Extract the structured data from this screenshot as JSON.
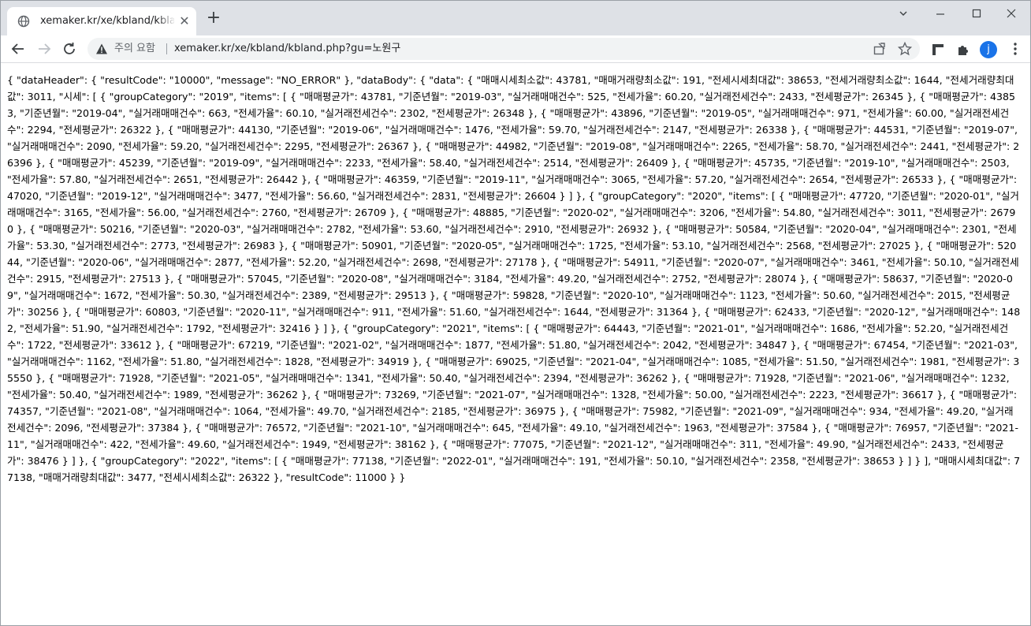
{
  "tab": {
    "title": "xemaker.kr/xe/kbland/kbland.php?gu=노원구",
    "globe_icon": "globe-icon"
  },
  "address_bar": {
    "warning_label": "주의 요함",
    "url": "xemaker.kr/xe/kbland/kbland.php?gu=노원구"
  },
  "profile": {
    "initial": "j",
    "color": "#1a73e8"
  },
  "page": {
    "body_text": "{ \"dataHeader\": { \"resultCode\": \"10000\", \"message\": \"NO_ERROR\" }, \"dataBody\": { \"data\": { \"매매시세최소값\": 43781, \"매매거래량최소값\": 191, \"전세시세최대값\": 38653, \"전세거래량최소값\": 1644, \"전세거래량최대값\": 3011, \"시세\": [ { \"groupCategory\": \"2019\", \"items\": [ { \"매매평균가\": 43781, \"기준년월\": \"2019-03\", \"실거래매매건수\": 525, \"전세가율\": 60.20, \"실거래전세건수\": 2433, \"전세평균가\": 26345 }, { \"매매평균가\": 43853, \"기준년월\": \"2019-04\", \"실거래매매건수\": 663, \"전세가율\": 60.10, \"실거래전세건수\": 2302, \"전세평균가\": 26348 }, { \"매매평균가\": 43896, \"기준년월\": \"2019-05\", \"실거래매매건수\": 971, \"전세가율\": 60.00, \"실거래전세건수\": 2294, \"전세평균가\": 26322 }, { \"매매평균가\": 44130, \"기준년월\": \"2019-06\", \"실거래매매건수\": 1476, \"전세가율\": 59.70, \"실거래전세건수\": 2147, \"전세평균가\": 26338 }, { \"매매평균가\": 44531, \"기준년월\": \"2019-07\", \"실거래매매건수\": 2090, \"전세가율\": 59.20, \"실거래전세건수\": 2295, \"전세평균가\": 26367 }, { \"매매평균가\": 44982, \"기준년월\": \"2019-08\", \"실거래매매건수\": 2265, \"전세가율\": 58.70, \"실거래전세건수\": 2441, \"전세평균가\": 26396 }, { \"매매평균가\": 45239, \"기준년월\": \"2019-09\", \"실거래매매건수\": 2233, \"전세가율\": 58.40, \"실거래전세건수\": 2514, \"전세평균가\": 26409 }, { \"매매평균가\": 45735, \"기준년월\": \"2019-10\", \"실거래매매건수\": 2503, \"전세가율\": 57.80, \"실거래전세건수\": 2651, \"전세평균가\": 26442 }, { \"매매평균가\": 46359, \"기준년월\": \"2019-11\", \"실거래매매건수\": 3065, \"전세가율\": 57.20, \"실거래전세건수\": 2654, \"전세평균가\": 26533 }, { \"매매평균가\": 47020, \"기준년월\": \"2019-12\", \"실거래매매건수\": 3477, \"전세가율\": 56.60, \"실거래전세건수\": 2831, \"전세평균가\": 26604 } ] }, { \"groupCategory\": \"2020\", \"items\": [ { \"매매평균가\": 47720, \"기준년월\": \"2020-01\", \"실거래매매건수\": 3165, \"전세가율\": 56.00, \"실거래전세건수\": 2760, \"전세평균가\": 26709 }, { \"매매평균가\": 48885, \"기준년월\": \"2020-02\", \"실거래매매건수\": 3206, \"전세가율\": 54.80, \"실거래전세건수\": 3011, \"전세평균가\": 26790 }, { \"매매평균가\": 50216, \"기준년월\": \"2020-03\", \"실거래매매건수\": 2782, \"전세가율\": 53.60, \"실거래전세건수\": 2910, \"전세평균가\": 26932 }, { \"매매평균가\": 50584, \"기준년월\": \"2020-04\", \"실거래매매건수\": 2301, \"전세가율\": 53.30, \"실거래전세건수\": 2773, \"전세평균가\": 26983 }, { \"매매평균가\": 50901, \"기준년월\": \"2020-05\", \"실거래매매건수\": 1725, \"전세가율\": 53.10, \"실거래전세건수\": 2568, \"전세평균가\": 27025 }, { \"매매평균가\": 52044, \"기준년월\": \"2020-06\", \"실거래매매건수\": 2877, \"전세가율\": 52.20, \"실거래전세건수\": 2698, \"전세평균가\": 27178 }, { \"매매평균가\": 54911, \"기준년월\": \"2020-07\", \"실거래매매건수\": 3461, \"전세가율\": 50.10, \"실거래전세건수\": 2915, \"전세평균가\": 27513 }, { \"매매평균가\": 57045, \"기준년월\": \"2020-08\", \"실거래매매건수\": 3184, \"전세가율\": 49.20, \"실거래전세건수\": 2752, \"전세평균가\": 28074 }, { \"매매평균가\": 58637, \"기준년월\": \"2020-09\", \"실거래매매건수\": 1672, \"전세가율\": 50.30, \"실거래전세건수\": 2389, \"전세평균가\": 29513 }, { \"매매평균가\": 59828, \"기준년월\": \"2020-10\", \"실거래매매건수\": 1123, \"전세가율\": 50.60, \"실거래전세건수\": 2015, \"전세평균가\": 30256 }, { \"매매평균가\": 60803, \"기준년월\": \"2020-11\", \"실거래매매건수\": 911, \"전세가율\": 51.60, \"실거래전세건수\": 1644, \"전세평균가\": 31364 }, { \"매매평균가\": 62433, \"기준년월\": \"2020-12\", \"실거래매매건수\": 1482, \"전세가율\": 51.90, \"실거래전세건수\": 1792, \"전세평균가\": 32416 } ] }, { \"groupCategory\": \"2021\", \"items\": [ { \"매매평균가\": 64443, \"기준년월\": \"2021-01\", \"실거래매매건수\": 1686, \"전세가율\": 52.20, \"실거래전세건수\": 1722, \"전세평균가\": 33612 }, { \"매매평균가\": 67219, \"기준년월\": \"2021-02\", \"실거래매매건수\": 1877, \"전세가율\": 51.80, \"실거래전세건수\": 2042, \"전세평균가\": 34847 }, { \"매매평균가\": 67454, \"기준년월\": \"2021-03\", \"실거래매매건수\": 1162, \"전세가율\": 51.80, \"실거래전세건수\": 1828, \"전세평균가\": 34919 }, { \"매매평균가\": 69025, \"기준년월\": \"2021-04\", \"실거래매매건수\": 1085, \"전세가율\": 51.50, \"실거래전세건수\": 1981, \"전세평균가\": 35550 }, { \"매매평균가\": 71928, \"기준년월\": \"2021-05\", \"실거래매매건수\": 1341, \"전세가율\": 50.40, \"실거래전세건수\": 2394, \"전세평균가\": 36262 }, { \"매매평균가\": 71928, \"기준년월\": \"2021-06\", \"실거래매매건수\": 1232, \"전세가율\": 50.40, \"실거래전세건수\": 1989, \"전세평균가\": 36262 }, { \"매매평균가\": 73269, \"기준년월\": \"2021-07\", \"실거래매매건수\": 1328, \"전세가율\": 50.00, \"실거래전세건수\": 2223, \"전세평균가\": 36617 }, { \"매매평균가\": 74357, \"기준년월\": \"2021-08\", \"실거래매매건수\": 1064, \"전세가율\": 49.70, \"실거래전세건수\": 2185, \"전세평균가\": 36975 }, { \"매매평균가\": 75982, \"기준년월\": \"2021-09\", \"실거래매매건수\": 934, \"전세가율\": 49.20, \"실거래전세건수\": 2096, \"전세평균가\": 37384 }, { \"매매평균가\": 76572, \"기준년월\": \"2021-10\", \"실거래매매건수\": 645, \"전세가율\": 49.10, \"실거래전세건수\": 1963, \"전세평균가\": 37584 }, { \"매매평균가\": 76957, \"기준년월\": \"2021-11\", \"실거래매매건수\": 422, \"전세가율\": 49.60, \"실거래전세건수\": 1949, \"전세평균가\": 38162 }, { \"매매평균가\": 77075, \"기준년월\": \"2021-12\", \"실거래매매건수\": 311, \"전세가율\": 49.90, \"실거래전세건수\": 2433, \"전세평균가\": 38476 } ] }, { \"groupCategory\": \"2022\", \"items\": [ { \"매매평균가\": 77138, \"기준년월\": \"2022-01\", \"실거래매매건수\": 191, \"전세가율\": 50.10, \"실거래전세건수\": 2358, \"전세평균가\": 38653 } ] } ], \"매매시세최대값\": 77138, \"매매거래량최대값\": 3477, \"전세시세최소값\": 26322 }, \"resultCode\": 11000 } }"
  }
}
